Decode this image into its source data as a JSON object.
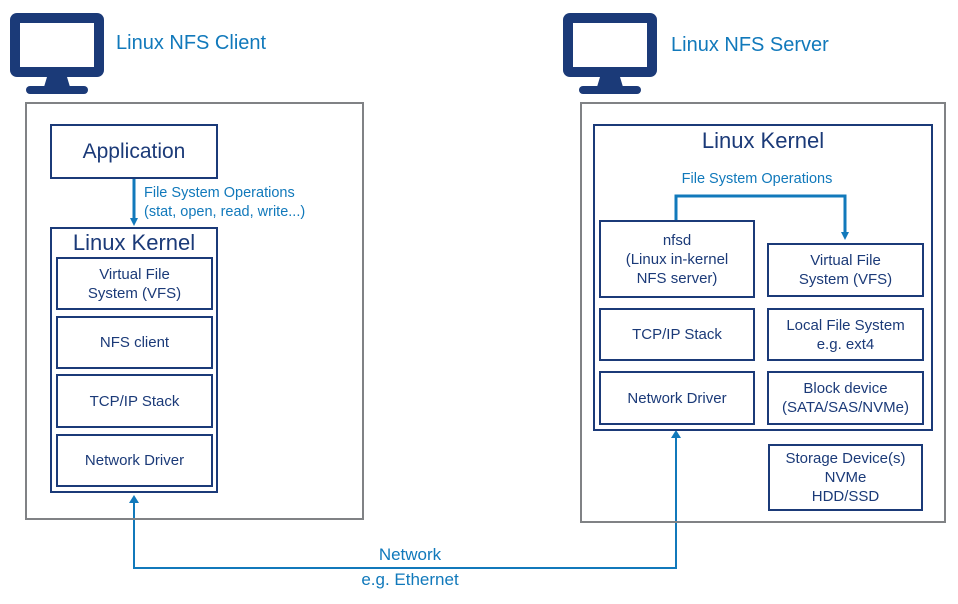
{
  "colors": {
    "navy": "#1b3a78",
    "accent_blue": "#1179bb",
    "host_border": "#808285"
  },
  "client": {
    "icon": "monitor-icon",
    "title": "Linux NFS Client",
    "application": "Application",
    "operations_label_line1": "File System Operations",
    "operations_label_line2": "(stat, open, read, write...)",
    "kernel": {
      "title": "Linux Kernel",
      "layers": [
        {
          "line1": "Virtual File",
          "line2": "System (VFS)"
        },
        {
          "line1": "NFS client"
        },
        {
          "line1": "TCP/IP Stack"
        },
        {
          "line1": "Network Driver"
        }
      ]
    }
  },
  "server": {
    "icon": "monitor-icon",
    "title": "Linux NFS Server",
    "kernel": {
      "title": "Linux Kernel",
      "operations_label": "File System Operations",
      "left_column": [
        {
          "line1": "nfsd",
          "line2": "(Linux in-kernel",
          "line3": "NFS server)"
        },
        {
          "line1": "TCP/IP Stack"
        },
        {
          "line1": "Network Driver"
        }
      ],
      "right_column": [
        {
          "line1": "Virtual File",
          "line2": "System (VFS)"
        },
        {
          "line1": "Local File System",
          "line2": "e.g. ext4"
        },
        {
          "line1": "Block device",
          "line2": "(SATA/SAS/NVMe)"
        }
      ]
    },
    "storage": {
      "line1": "Storage Device(s)",
      "line2": "NVMe",
      "line3": "HDD/SSD"
    }
  },
  "network": {
    "label_line1": "Network",
    "label_line2": "e.g. Ethernet"
  }
}
